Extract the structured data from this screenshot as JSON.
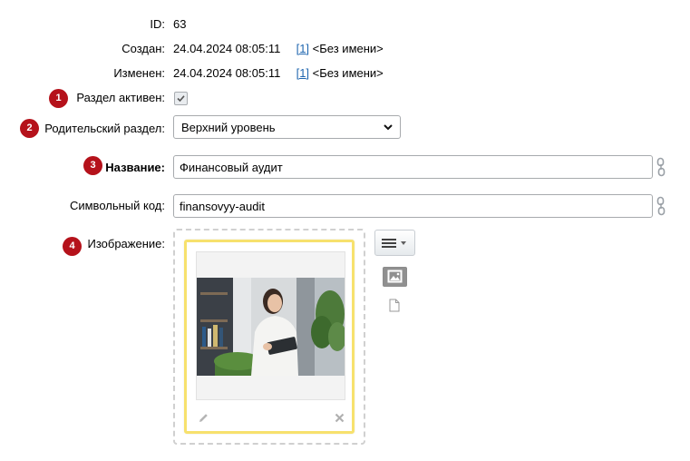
{
  "fields": {
    "id": {
      "label": "ID:",
      "value": "63"
    },
    "created": {
      "label": "Создан:",
      "date": "24.04.2024 08:05:11",
      "user_link": "[1]",
      "user_name": "<Без имени>"
    },
    "modified": {
      "label": "Изменен:",
      "date": "24.04.2024 08:05:11",
      "user_link": "[1]",
      "user_name": "<Без имени>"
    },
    "active": {
      "label": "Раздел активен:",
      "checked": true
    },
    "parent": {
      "label": "Родительский раздел:",
      "selected": "Верхний уровень"
    },
    "name": {
      "label": "Название:",
      "value": "Финансовый аудит"
    },
    "code": {
      "label": "Символьный код:",
      "value": "finansovyy-audit"
    },
    "image": {
      "label": "Изображение:"
    }
  },
  "badges": [
    "1",
    "2",
    "3",
    "4"
  ],
  "colors": {
    "badge": "#b5121b",
    "link": "#2067b0",
    "card_border": "#f7e16d"
  },
  "icons": [
    "checkmark-icon",
    "chevron-down-icon",
    "chain-link-icon",
    "hamburger-menu-icon",
    "image-file-icon",
    "document-icon",
    "pencil-icon",
    "close-icon"
  ]
}
